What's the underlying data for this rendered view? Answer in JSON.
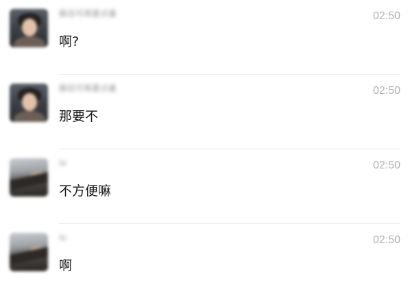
{
  "messages": [
    {
      "sender": "蘇目可苒要点番",
      "time": "02:50",
      "text": "啊?"
    },
    {
      "sender": "蘇目可苒要点番",
      "time": "02:50",
      "text": "那要不"
    },
    {
      "sender": "lo",
      "time": "02:50",
      "text": "不方便嘛"
    },
    {
      "sender": "lo",
      "time": "02:50",
      "text": "啊"
    }
  ]
}
